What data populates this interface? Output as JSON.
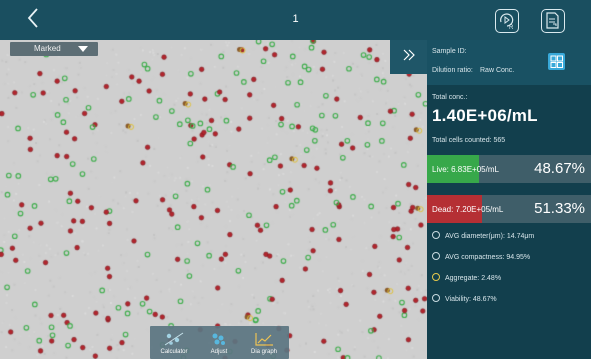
{
  "topbar": {
    "back_icon": "chevron-left-icon",
    "page_number": "1",
    "replay_icon": "replay-r-icon",
    "export_icon": "export-document-icon"
  },
  "image": {
    "dropdown_value": "Marked",
    "colors": {
      "live": "#3fae4c",
      "dead": "#b3262e",
      "background": "#cfcfcf"
    }
  },
  "tools": [
    {
      "label": "Calculator",
      "icon": "calculator-icon"
    },
    {
      "label": "Adjust",
      "icon": "adjust-icon"
    },
    {
      "label": "Dia graph",
      "icon": "diagram-graph-icon"
    }
  ],
  "panel": {
    "sample_id": "Sample ID:",
    "dilution_label": "Dilution ratio:",
    "dilution_value": "Raw Conc.",
    "total_conc_label": "Total conc.:",
    "total_conc_value": "1.40E+06/mL",
    "cells_counted": "Total cells counted: 565",
    "live": {
      "text": "Live:  6.83E+05/mL",
      "percent": "48.67%",
      "fraction": 0.4867,
      "color": "#37a84a"
    },
    "dead": {
      "text": "Dead:  7.20E+05/mL",
      "percent": "51.33%",
      "fraction": 0.5133,
      "color": "#b52f34"
    },
    "stats": [
      {
        "label": "AVG diameter(μm):",
        "value": "14.74μm",
        "icon": "diameter-icon"
      },
      {
        "label": "AVG compactness:",
        "value": "94.95%",
        "icon": "compactness-icon"
      },
      {
        "label": "Aggregate:",
        "value": "2.48%",
        "icon": "aggregate-icon"
      },
      {
        "label": "Viability:",
        "value": "48.67%",
        "icon": "viability-icon"
      }
    ]
  }
}
